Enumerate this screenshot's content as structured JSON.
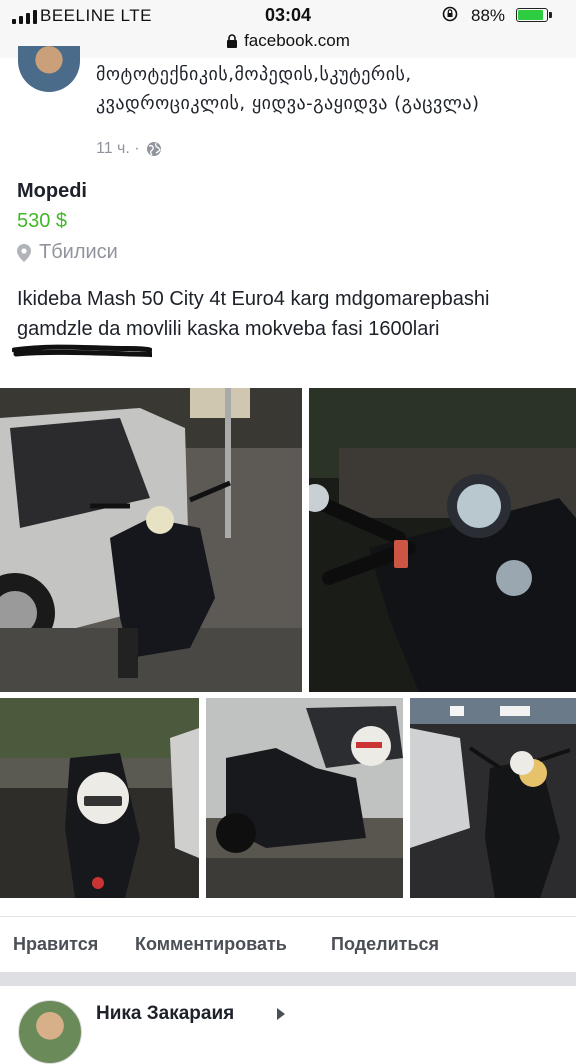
{
  "status_bar": {
    "carrier": "BEELINE  LTE",
    "time": "03:04",
    "battery_percent": "88%",
    "battery_level": 0.88,
    "url": "facebook.com"
  },
  "post": {
    "group_name": "მოტოტექნიკის,მოპედის,სკუტერის, კვადროციკლის, ყიდვა-გაყიდვა (გაცვლა)",
    "time_ago": "11 ч. ·"
  },
  "listing": {
    "title": "Mopedi",
    "price": "530 $",
    "location": "Тбилиси",
    "description_line1": "Ikideba Mash 50 City 4t Euro4 karg mdgomarepbashi",
    "description_line2": "gamdzle da movlili kaska mokveba fasi 1600lari"
  },
  "actions": {
    "like": "Нравится",
    "comment": "Комментировать",
    "share": "Поделиться"
  },
  "next_post": {
    "author": "Ника Закараия"
  },
  "icons": {
    "lock": "lock-icon",
    "globe": "globe-icon",
    "location": "location-pin-icon",
    "rotation_lock": "rotation-lock-icon"
  },
  "colors": {
    "price": "#42b72a",
    "meta": "#90949c",
    "battery": "#2ecc40"
  }
}
